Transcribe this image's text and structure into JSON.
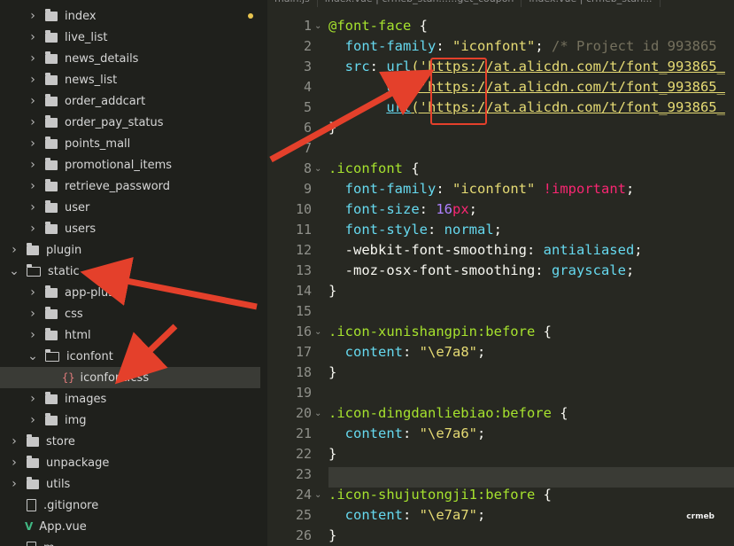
{
  "tabs": [
    "main.js",
    "index.vue | crmeb_stan......get_coupon",
    "index.vue | crmeb_stan..."
  ],
  "file_tree": [
    {
      "label": "index",
      "kind": "folder",
      "modified": true
    },
    {
      "label": "live_list",
      "kind": "folder"
    },
    {
      "label": "news_details",
      "kind": "folder"
    },
    {
      "label": "news_list",
      "kind": "folder"
    },
    {
      "label": "order_addcart",
      "kind": "folder"
    },
    {
      "label": "order_pay_status",
      "kind": "folder"
    },
    {
      "label": "points_mall",
      "kind": "folder"
    },
    {
      "label": "promotional_items",
      "kind": "folder"
    },
    {
      "label": "retrieve_password",
      "kind": "folder"
    },
    {
      "label": "user",
      "kind": "folder"
    },
    {
      "label": "users",
      "kind": "folder"
    },
    {
      "label": "plugin",
      "kind": "folder"
    },
    {
      "label": "static",
      "kind": "folder-open"
    },
    {
      "label": "app-plus",
      "kind": "folder"
    },
    {
      "label": "css",
      "kind": "folder"
    },
    {
      "label": "html",
      "kind": "folder"
    },
    {
      "label": "iconfont",
      "kind": "folder-open"
    },
    {
      "label": "iconfont.css",
      "kind": "css-file",
      "selected": true
    },
    {
      "label": "images",
      "kind": "folder"
    },
    {
      "label": "img",
      "kind": "folder"
    },
    {
      "label": "store",
      "kind": "folder"
    },
    {
      "label": "unpackage",
      "kind": "folder"
    },
    {
      "label": "utils",
      "kind": "folder"
    },
    {
      "label": ".gitignore",
      "kind": "file"
    },
    {
      "label": "App.vue",
      "kind": "vue-file"
    },
    {
      "label": "m...",
      "kind": "file"
    }
  ],
  "code": {
    "line_numbers": [
      "1",
      "2",
      "3",
      "4",
      "5",
      "6",
      "7",
      "8",
      "9",
      "10",
      "11",
      "12",
      "13",
      "14",
      "15",
      "16",
      "17",
      "18",
      "19",
      "20",
      "21",
      "22",
      "23",
      "24",
      "25",
      "26"
    ],
    "lines": [
      [
        {
          "t": "@font-face",
          "c": "sel"
        },
        {
          "t": " {"
        }
      ],
      [
        {
          "t": "  font-family",
          "c": "kw"
        },
        {
          "t": ": "
        },
        {
          "t": "\"iconfont\"",
          "c": "str"
        },
        {
          "t": "; "
        },
        {
          "t": "/* Project id 993865",
          "c": "cmt"
        }
      ],
      [
        {
          "t": "  src",
          "c": "kw"
        },
        {
          "t": ": "
        },
        {
          "t": "url",
          "c": "url-fn"
        },
        {
          "t": "('https://at.alicdn.com/t/font_993865_",
          "c": "url-str"
        }
      ],
      [
        {
          "t": "       "
        },
        {
          "t": "url",
          "c": "url-fn"
        },
        {
          "t": "('https://at.alicdn.com/t/font_993865_",
          "c": "url-str"
        }
      ],
      [
        {
          "t": "       "
        },
        {
          "t": "url",
          "c": "url-fn"
        },
        {
          "t": "('https://at.alicdn.com/t/font_993865_",
          "c": "url-str"
        }
      ],
      [
        {
          "t": "}"
        }
      ],
      [
        {
          "t": ""
        }
      ],
      [
        {
          "t": ".iconfont",
          "c": "sel"
        },
        {
          "t": " {"
        }
      ],
      [
        {
          "t": "  font-family",
          "c": "kw"
        },
        {
          "t": ": "
        },
        {
          "t": "\"iconfont\"",
          "c": "str"
        },
        {
          "t": " "
        },
        {
          "t": "!important",
          "c": "imp"
        },
        {
          "t": ";"
        }
      ],
      [
        {
          "t": "  font-size",
          "c": "kw"
        },
        {
          "t": ": "
        },
        {
          "t": "16",
          "c": "num"
        },
        {
          "t": "px",
          "c": "unit"
        },
        {
          "t": ";"
        }
      ],
      [
        {
          "t": "  font-style",
          "c": "kw"
        },
        {
          "t": ": "
        },
        {
          "t": "normal",
          "c": "kw"
        },
        {
          "t": ";"
        }
      ],
      [
        {
          "t": "  -webkit-font-smoothing",
          "c": ""
        },
        {
          "t": ": "
        },
        {
          "t": "antialiased",
          "c": "kw"
        },
        {
          "t": ";"
        }
      ],
      [
        {
          "t": "  -moz-osx-font-smoothing",
          "c": ""
        },
        {
          "t": ": "
        },
        {
          "t": "grayscale",
          "c": "kw"
        },
        {
          "t": ";"
        }
      ],
      [
        {
          "t": "}"
        }
      ],
      [
        {
          "t": ""
        }
      ],
      [
        {
          "t": ".icon-xunishangpin:before",
          "c": "sel"
        },
        {
          "t": " {"
        }
      ],
      [
        {
          "t": "  content",
          "c": "kw"
        },
        {
          "t": ": "
        },
        {
          "t": "\"\\e7a8\"",
          "c": "str"
        },
        {
          "t": ";"
        }
      ],
      [
        {
          "t": "}"
        }
      ],
      [
        {
          "t": ""
        }
      ],
      [
        {
          "t": ".icon-dingdanliebiao:before",
          "c": "sel"
        },
        {
          "t": " {"
        }
      ],
      [
        {
          "t": "  content",
          "c": "kw"
        },
        {
          "t": ": "
        },
        {
          "t": "\"\\e7a6\"",
          "c": "str"
        },
        {
          "t": ";"
        }
      ],
      [
        {
          "t": "}"
        }
      ],
      [
        {
          "t": ""
        }
      ],
      [
        {
          "t": ".icon-shujutongji1:before",
          "c": "sel"
        },
        {
          "t": " {"
        }
      ],
      [
        {
          "t": "  content",
          "c": "kw"
        },
        {
          "t": ": "
        },
        {
          "t": "\"\\e7a7\"",
          "c": "str"
        },
        {
          "t": ";"
        }
      ],
      [
        {
          "t": "}"
        }
      ]
    ],
    "fold_lines": [
      1,
      8,
      16,
      20,
      24
    ]
  },
  "watermark": "crmeb",
  "annotation_color": "#e4402b"
}
